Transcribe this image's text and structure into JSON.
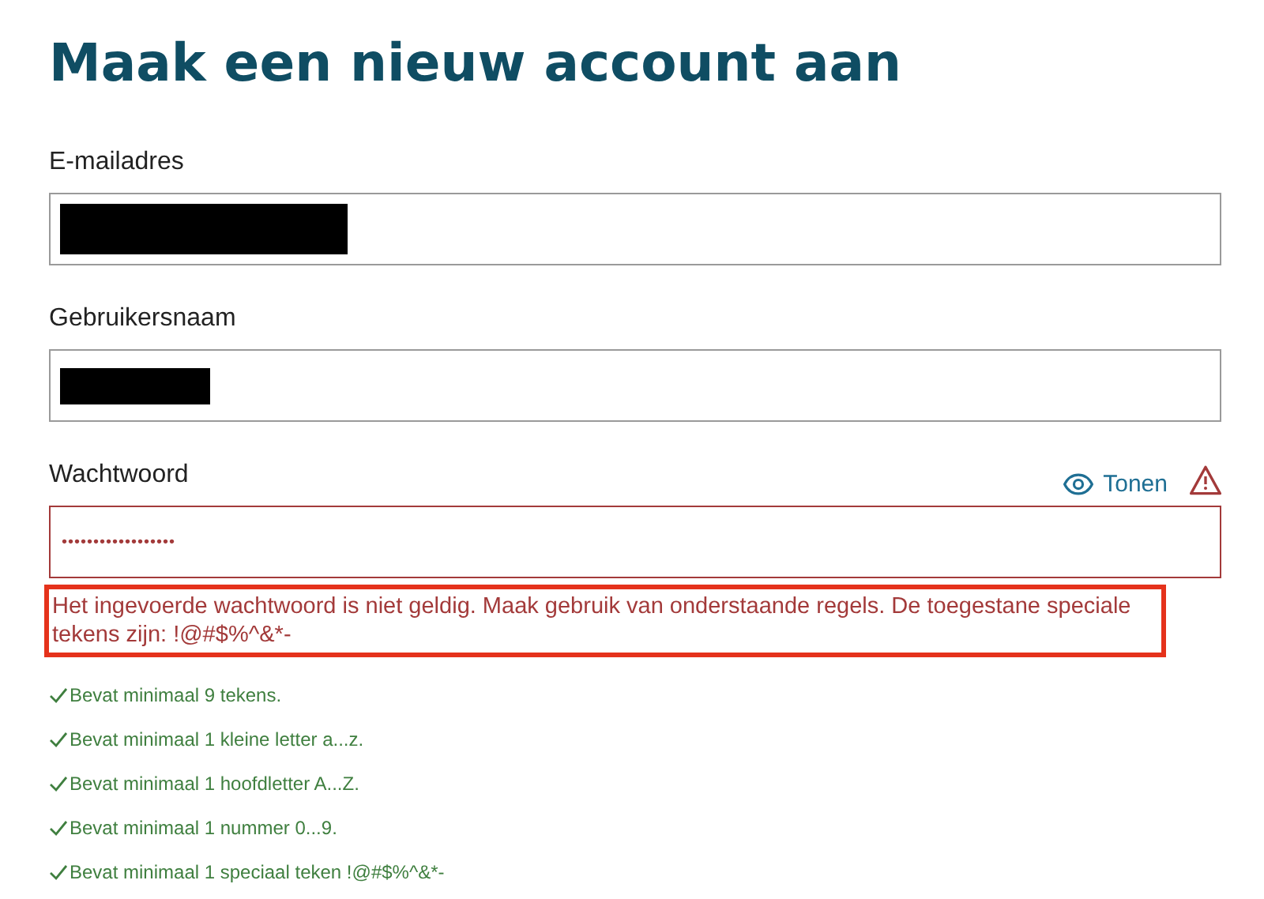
{
  "title": "Maak een nieuw account aan",
  "fields": [
    {
      "label": "E-mailadres",
      "kind": "redacted",
      "invalid": false
    },
    {
      "label": "Gebruikersnaam",
      "kind": "redacted",
      "invalid": false
    },
    {
      "label": "Wachtwoord",
      "kind": "password",
      "value": "••••••••••••••••••",
      "invalid": true,
      "toggle": "Tonen"
    }
  ],
  "error": {
    "text": "Het ingevoerde wachtwoord is niet geldig. Maak gebruik van onderstaande regels. De toegestane speciale tekens zijn: !@#$%^&*-",
    "highlighted": true
  },
  "rules": [
    {
      "text": "Bevat minimaal 9 tekens.",
      "met": true
    },
    {
      "text": "Bevat minimaal 1 kleine letter a...z.",
      "met": true
    },
    {
      "text": "Bevat minimaal 1 hoofdletter A...Z.",
      "met": true
    },
    {
      "text": "Bevat minimaal 1 nummer 0...9.",
      "met": true
    },
    {
      "text": "Bevat minimaal 1 speciaal teken !@#$%^&*-",
      "met": true
    }
  ]
}
